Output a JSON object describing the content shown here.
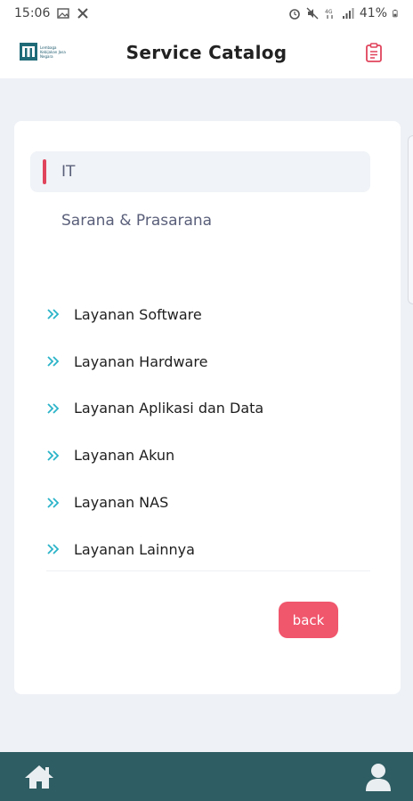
{
  "status_bar": {
    "time": "15:06",
    "battery": "41%",
    "icons": [
      "image-icon",
      "tools-icon",
      "alarm-icon",
      "mute-icon",
      "4g-icon",
      "signal-icon",
      "battery-icon"
    ]
  },
  "header": {
    "title": "Service Catalog",
    "logo_text": "Lembaga Kebijakan Jasa Negara",
    "action_icon": "clipboard-icon"
  },
  "categories": [
    {
      "label": "IT",
      "active": true
    },
    {
      "label": "Sarana & Prasarana",
      "active": false
    }
  ],
  "services": [
    {
      "label": "Layanan Software"
    },
    {
      "label": "Layanan Hardware"
    },
    {
      "label": "Layanan Aplikasi dan Data"
    },
    {
      "label": "Layanan Akun"
    },
    {
      "label": "Layanan NAS"
    },
    {
      "label": "Layanan Lainnya"
    }
  ],
  "back_label": "back",
  "bottom_nav": {
    "home_icon": "home-icon",
    "profile_icon": "profile-icon"
  },
  "colors": {
    "accent_red": "#f0566c",
    "indicator": "#e0445c",
    "nav_bg": "#2e5d63",
    "chevron": "#2ab3c8",
    "background": "#eef1f6"
  }
}
